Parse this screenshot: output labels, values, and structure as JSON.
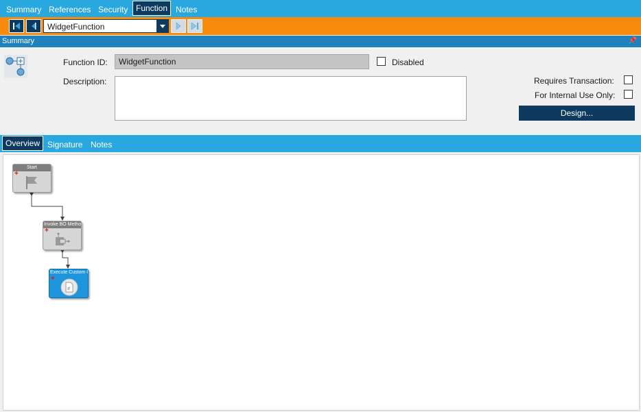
{
  "top_tabs": [
    {
      "label": "Summary"
    },
    {
      "label": "References"
    },
    {
      "label": "Security"
    },
    {
      "label": "Function"
    },
    {
      "label": "Notes"
    }
  ],
  "nav": {
    "selected_function": "WidgetFunction"
  },
  "summary": {
    "header": "Summary",
    "function_id_label": "Function ID:",
    "function_id_value": "WidgetFunction",
    "disabled_label": "Disabled",
    "description_label": "Description:",
    "description_value": "",
    "requires_transaction_label": "Requires Transaction:",
    "internal_use_label": "For Internal Use Only:",
    "design_button": "Design..."
  },
  "lower_tabs": [
    {
      "label": "Overview"
    },
    {
      "label": "Signature"
    },
    {
      "label": "Notes"
    }
  ],
  "flow": {
    "nodes": [
      {
        "title": "Start"
      },
      {
        "title": "Invoke BO Method"
      },
      {
        "title": "Execute Custom Co"
      }
    ]
  },
  "colors": {
    "accent_blue": "#29a8e0",
    "dark_navy": "#0d3a5e",
    "orange": "#f88a0c",
    "header_blue": "#1f82bd",
    "node_gray": "#d4d4d4",
    "node_selected": "#1d95dc"
  }
}
